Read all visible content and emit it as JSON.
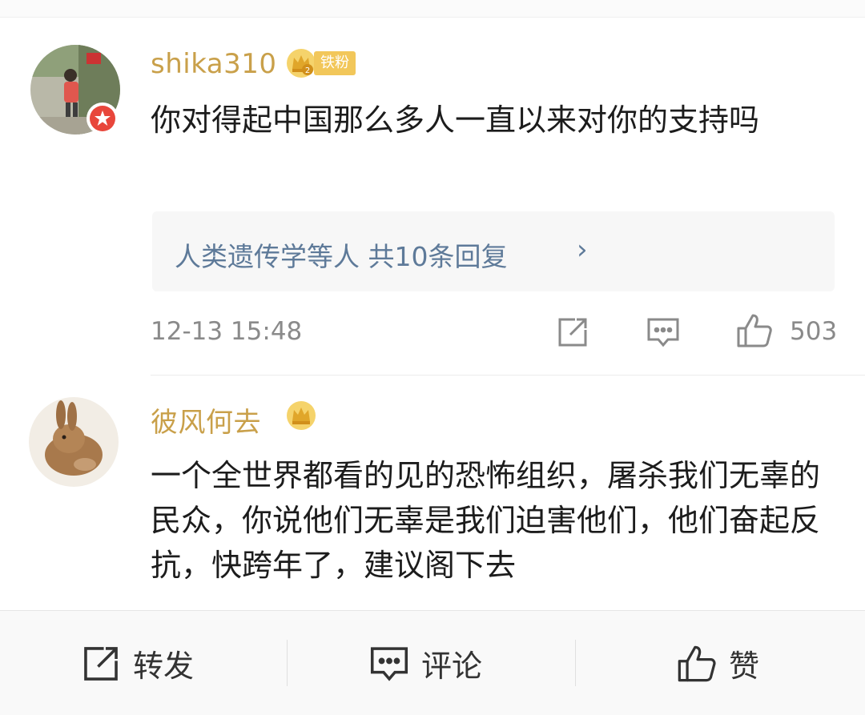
{
  "comments": [
    {
      "username": "shika310",
      "fan_tag": "铁粉",
      "content": "你对得起中国那么多人一直以来对你的支持吗",
      "reply_summary": "人类遗传学等人  共10条回复",
      "reply_chevron": "›",
      "time": "12-13 15:48",
      "like_count": "503"
    },
    {
      "username": "彼风何去",
      "content": "一个全世界都看的见的恐怖组织，屠杀我们无辜的民众，你说他们无辜是我们迫害他们，他们奋起反抗，快跨年了，建议阁下去"
    }
  ],
  "bottom_bar": {
    "repost_label": "转发",
    "comment_label": "评论",
    "like_label": "赞"
  },
  "colors": {
    "username": "#c9a04a",
    "link": "#5e7a99",
    "meta": "#8a8a8a",
    "fan_tag_bg": "#f2c75a",
    "vip_red": "#e8463b"
  }
}
